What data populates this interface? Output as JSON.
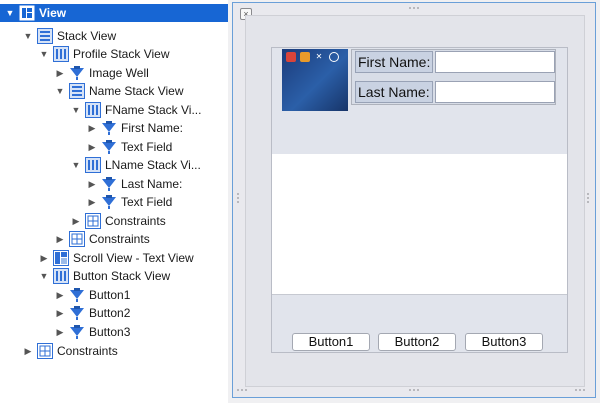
{
  "outline": {
    "items": [
      {
        "label": "View",
        "icon": "view-icon"
      },
      {
        "label": "Stack View",
        "icon": "vertical-stack-icon"
      },
      {
        "label": "Profile Stack View",
        "icon": "horizontal-stack-icon"
      },
      {
        "label": "Image Well",
        "icon": "view-object-icon"
      },
      {
        "label": "Name Stack View",
        "icon": "vertical-stack-icon"
      },
      {
        "label": "FName Stack Vi...",
        "icon": "horizontal-stack-icon"
      },
      {
        "label": "First Name:",
        "icon": "view-object-icon"
      },
      {
        "label": "Text Field",
        "icon": "view-object-icon"
      },
      {
        "label": "LName Stack Vi...",
        "icon": "horizontal-stack-icon"
      },
      {
        "label": "Last Name:",
        "icon": "view-object-icon"
      },
      {
        "label": "Text Field",
        "icon": "view-object-icon"
      },
      {
        "label": "Constraints",
        "icon": "constraints-icon"
      },
      {
        "label": "Constraints",
        "icon": "constraints-icon"
      },
      {
        "label": "Scroll View - Text View",
        "icon": "scroll-view-icon"
      },
      {
        "label": "Button Stack View",
        "icon": "horizontal-stack-icon"
      },
      {
        "label": "Button1",
        "icon": "view-object-icon"
      },
      {
        "label": "Button2",
        "icon": "view-object-icon"
      },
      {
        "label": "Button3",
        "icon": "view-object-icon"
      },
      {
        "label": "Constraints",
        "icon": "constraints-icon"
      }
    ]
  },
  "canvas": {
    "first_name_label": "First Name:",
    "last_name_label": "Last Name:",
    "buttons": [
      "Button1",
      "Button2",
      "Button3"
    ]
  },
  "colors": {
    "selection": "#1766d4",
    "icon_blue": "#2f6fd6",
    "canvas_border": "#6a9fd8"
  }
}
